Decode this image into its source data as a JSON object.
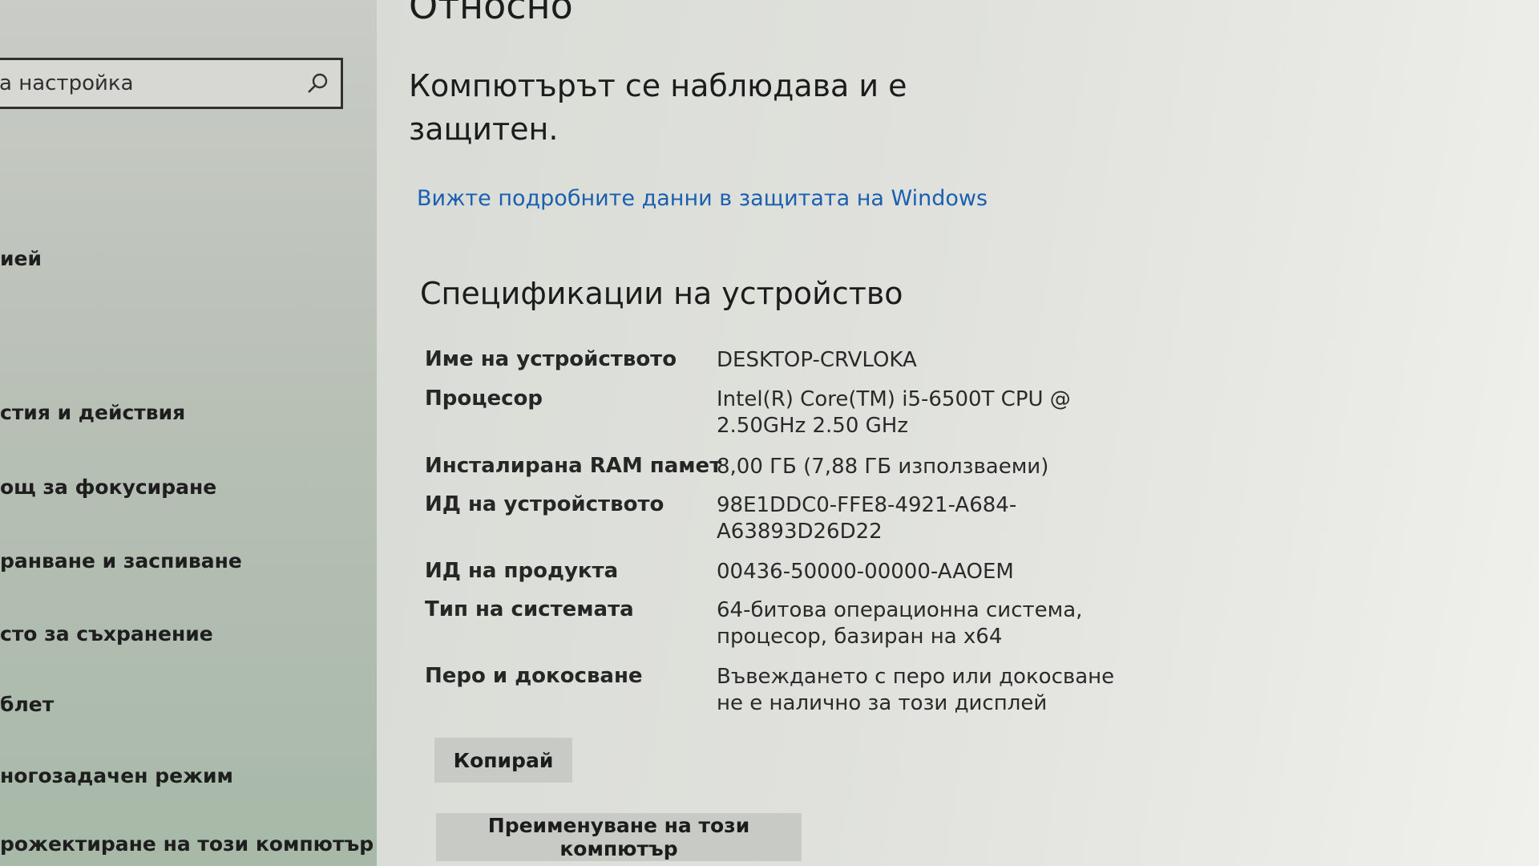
{
  "sidebar": {
    "search": {
      "placeholder": "а настройка"
    },
    "items": [
      {
        "label": "ией"
      },
      {
        "label": "стия и действия"
      },
      {
        "label": "ощ за фокусиране"
      },
      {
        "label": "ранване и заспиване"
      },
      {
        "label": "сто за съхранение"
      },
      {
        "label": "блет"
      },
      {
        "label": "ногозадачен режим"
      },
      {
        "label": "рожектиране на този компютър"
      }
    ]
  },
  "main": {
    "title": "Относно",
    "protection_status": "Компютърът се наблюдава и е защитен.",
    "details_link": "Вижте подробните данни в защитата на Windows",
    "specs_title": "Спецификации на устройство",
    "specs": [
      {
        "label": "Име на устройството",
        "value": "DESKTOP-CRVLOKA"
      },
      {
        "label": "Процесор",
        "value": "Intel(R) Core(TM) i5-6500T CPU @ 2.50GHz   2.50 GHz"
      },
      {
        "label": "Инсталирана RAM памет",
        "value": "8,00 ГБ (7,88 ГБ използваеми)"
      },
      {
        "label": "ИД на устройството",
        "value": "98E1DDC0-FFE8-4921-A684-A63893D26D22"
      },
      {
        "label": "ИД на продукта",
        "value": "00436-50000-00000-AAOEM"
      },
      {
        "label": "Тип на системата",
        "value": "64-битова операционна система, процесор, базиран на x64"
      },
      {
        "label": "Перо и докосване",
        "value": "Въвеждането с перо или докосване не е налично за този дисплей"
      }
    ],
    "copy_button": "Копирай",
    "rename_button": "Преименуване на този компютър"
  }
}
